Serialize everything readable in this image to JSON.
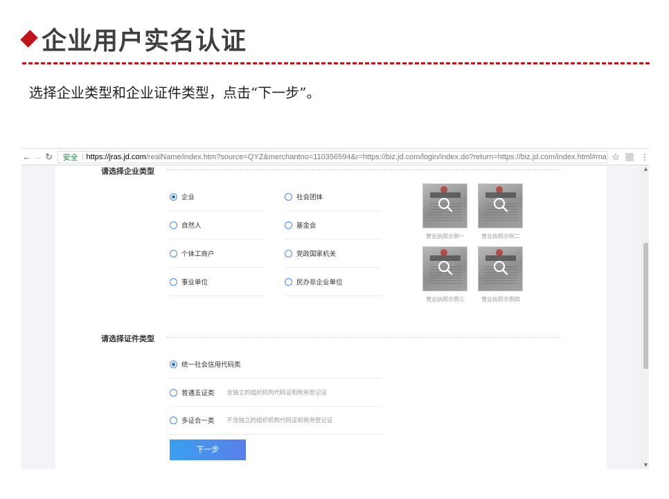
{
  "slide": {
    "title": "企业用户实名认证",
    "instruction": "选择企业类型和企业证件类型，点击“下一步”。"
  },
  "browser": {
    "secure_label": "安全",
    "url_host": "https://jras.jd.com",
    "url_rest": "/realName/index.htm?source=QYZ&merchantno=110356594&r=https://biz.jd.com/login/index.do?return=https://biz.jd.com/index.html#main/a..."
  },
  "enterprise_type": {
    "title": "请选择企业类型",
    "options": [
      {
        "label": "企业",
        "checked": true
      },
      {
        "label": "社会团体",
        "checked": false
      },
      {
        "label": "自然人",
        "checked": false
      },
      {
        "label": "基金会",
        "checked": false
      },
      {
        "label": "个体工商户",
        "checked": false
      },
      {
        "label": "党政国家机关",
        "checked": false
      },
      {
        "label": "事业单位",
        "checked": false
      },
      {
        "label": "民办非企业单位",
        "checked": false
      }
    ],
    "examples": [
      {
        "caption": "营业执照示例一"
      },
      {
        "caption": "营业执照示例二"
      },
      {
        "caption": "营业执照示例三"
      },
      {
        "caption": "营业执照示例四"
      }
    ]
  },
  "certificate_type": {
    "title": "请选择证件类型",
    "options": [
      {
        "label": "统一社会信用代码类",
        "hint": "",
        "checked": true
      },
      {
        "label": "普通五证类",
        "hint": "含独立的组织机构代码证和税务登记证",
        "checked": false
      },
      {
        "label": "多证合一类",
        "hint": "不含独立的组织机构代码证和税务登记证",
        "checked": false
      }
    ]
  },
  "next_button": {
    "label": "下一步"
  },
  "colors": {
    "accent_red": "#c0141b",
    "radio_blue": "#2f6fd6",
    "button_start": "#3aa0f0",
    "button_end": "#5a7fe8"
  }
}
